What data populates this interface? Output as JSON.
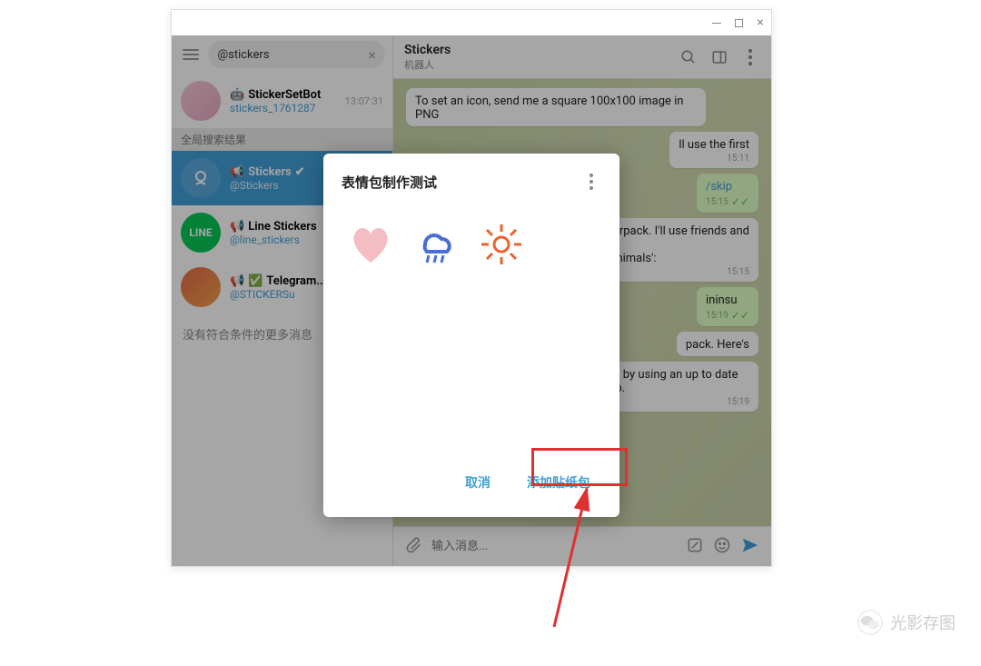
{
  "search": {
    "value": "@stickers"
  },
  "sidebar": {
    "item0": {
      "title": "StickerSetBot",
      "sub": "stickers_1761287",
      "time": "13:07:31"
    },
    "section1": "全局搜索结果",
    "item1": {
      "title": "Stickers",
      "sub": "@Stickers"
    },
    "item2": {
      "title": "Line Stickers",
      "sub": "@line_stickers"
    },
    "item3": {
      "title": "Telegram...",
      "sub": "@STICKERSu"
    },
    "empty": "没有符合条件的更多消息"
  },
  "header": {
    "title": "Stickers",
    "sub": "机器人"
  },
  "messages": {
    "m1": {
      "text": "To set an icon, send me a square 100x100 image in PNG"
    },
    "m2": {
      "text": "ll use the first",
      "time": "15:11"
    },
    "m3": {
      "text": "/skip",
      "time": "15:15"
    },
    "m4": {
      "text": "kerpack. I'll use friends and",
      "text2": "'Animals':",
      "time": "15:15"
    },
    "m5": {
      "text": "ininsu",
      "time": "15:19"
    },
    "m6": {
      "text": "pack. Here's"
    },
    "m7": {
      "text": "s — they'll be anel by using an up to date version of the app.",
      "time": "15:19"
    }
  },
  "composer": {
    "placeholder": "输入消息..."
  },
  "modal": {
    "title": "表情包制作测试",
    "cancel": "取消",
    "add": "添加贴纸包"
  },
  "watermark": "光影存图"
}
